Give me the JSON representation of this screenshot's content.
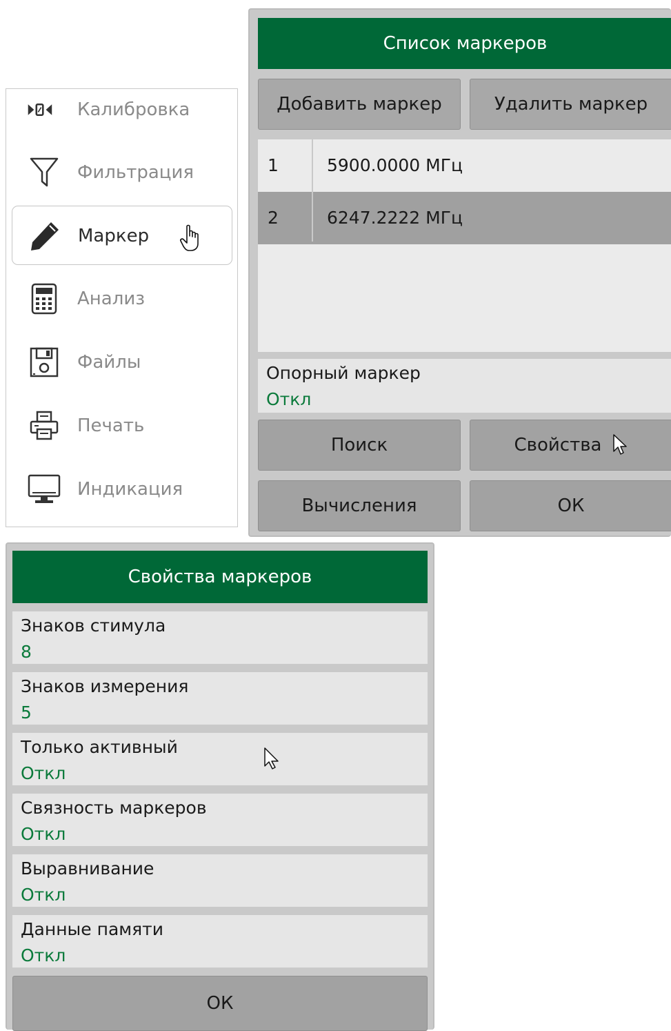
{
  "menu": {
    "items": [
      {
        "label": "Калибровка",
        "icon": "calibration-icon"
      },
      {
        "label": "Фильтрация",
        "icon": "filter-icon"
      },
      {
        "label": "Маркер",
        "icon": "pencil-icon",
        "selected": true
      },
      {
        "label": "Анализ",
        "icon": "calculator-icon"
      },
      {
        "label": "Файлы",
        "icon": "floppy-disk-icon"
      },
      {
        "label": "Печать",
        "icon": "printer-icon"
      },
      {
        "label": "Индикация",
        "icon": "monitor-icon"
      }
    ]
  },
  "marker_list": {
    "title": "Список маркеров",
    "add_button": "Добавить маркер",
    "delete_button": "Удалить маркер",
    "markers": [
      {
        "num": "1",
        "freq": "5900.0000  МГц"
      },
      {
        "num": "2",
        "freq": "6247.2222  МГц",
        "selected": true
      }
    ],
    "reference": {
      "label": "Опорный маркер",
      "value": "Откл"
    },
    "search_button": "Поиск",
    "properties_button": "Свойства",
    "calc_button": "Вычисления",
    "ok_button": "ОК"
  },
  "marker_properties": {
    "title": "Свойства маркеров",
    "fields": [
      {
        "label": "Знаков стимула",
        "value": "8"
      },
      {
        "label": "Знаков измерения",
        "value": "5"
      },
      {
        "label": "Только активный",
        "value": "Откл"
      },
      {
        "label": "Связность маркеров",
        "value": "Откл"
      },
      {
        "label": "Выравнивание",
        "value": "Откл"
      },
      {
        "label": "Данные памяти",
        "value": "Откл"
      }
    ],
    "ok_button": "ОК"
  },
  "colors": {
    "title_green": "#006837",
    "value_green": "#0b7a3b",
    "panel_gray": "#c9c9c9",
    "button_gray": "#a2a2a2"
  }
}
